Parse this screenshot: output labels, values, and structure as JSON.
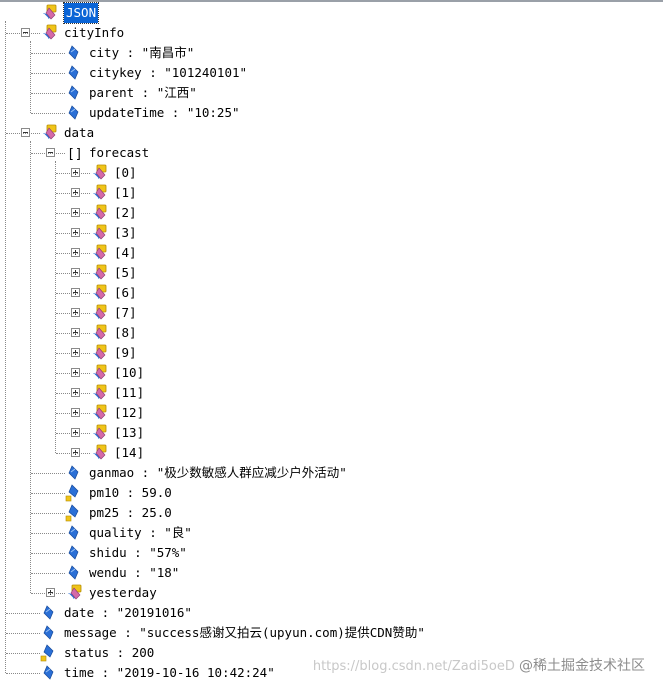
{
  "root": {
    "label": "JSON"
  },
  "cityInfo": {
    "label": "cityInfo",
    "city": "city : \"南昌市\"",
    "citykey": "citykey : \"101240101\"",
    "parent": "parent : \"江西\"",
    "updateTime": "updateTime : \"10:25\""
  },
  "data": {
    "label": "data",
    "forecast_label": "forecast",
    "forecast_items": [
      "[0]",
      "[1]",
      "[2]",
      "[3]",
      "[4]",
      "[5]",
      "[6]",
      "[7]",
      "[8]",
      "[9]",
      "[10]",
      "[11]",
      "[12]",
      "[13]",
      "[14]"
    ],
    "ganmao": "ganmao : \"极少数敏感人群应减少户外活动\"",
    "pm10": "pm10 : 59.0",
    "pm25": "pm25 : 25.0",
    "quality": "quality : \"良\"",
    "shidu": "shidu : \"57%\"",
    "wendu": "wendu : \"18\"",
    "yesterday": "yesterday"
  },
  "date": "date : \"20191016\"",
  "message": "message : \"success感谢又拍云(upyun.com)提供CDN赞助\"",
  "status": "status : 200",
  "time": "time : \"2019-10-16 10:42:24\"",
  "watermark": {
    "url": "https://blog.csdn.net/Zadi5oeD",
    "brand": "@稀土掘金技术社区"
  },
  "colors": {
    "selection": "#0a64d6",
    "leaf_icon": "#2a6fd6",
    "object_icon_yellow": "#f0c419",
    "object_icon_pink": "#d46aa8",
    "tree_line": "#8a8a8a"
  },
  "icons": {
    "object": "object-node-icon",
    "array": "array-brackets-icon",
    "leaf": "value-leaf-icon",
    "leaf_numeric": "numeric-leaf-icon"
  }
}
